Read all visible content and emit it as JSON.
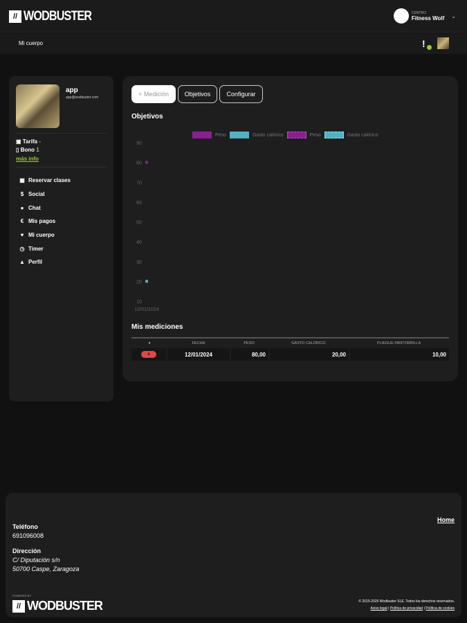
{
  "header": {
    "brand": "WODBUSTER",
    "brand_mark": "//",
    "centro_label": "CENTRO",
    "centro_name": "Fitness Wolf"
  },
  "subnav": {
    "title": "Mi cuerpo"
  },
  "user": {
    "name": "app",
    "email": "app@wodbuster.com",
    "tarifa_label": "Tarifa",
    "tarifa_value": "-",
    "bono_label": "Bono",
    "bono_value": "1",
    "more": "más info"
  },
  "menu": [
    {
      "icon": "calendar-icon",
      "glyph": "▦",
      "label": "Reservar clases"
    },
    {
      "icon": "social-icon",
      "glyph": "$",
      "label": "Social"
    },
    {
      "icon": "chat-icon",
      "glyph": "●",
      "label": "Chat"
    },
    {
      "icon": "euro-icon",
      "glyph": "€",
      "label": "Mis pagos"
    },
    {
      "icon": "heart-icon",
      "glyph": "♥",
      "label": "Mi cuerpo"
    },
    {
      "icon": "timer-icon",
      "glyph": "◷",
      "label": "Timer"
    },
    {
      "icon": "user-icon",
      "glyph": "▲",
      "label": "Perfil"
    }
  ],
  "main": {
    "buttons": {
      "add": "+ Medición",
      "goals": "Objetivos",
      "config": "Configurar"
    },
    "chart_title": "Objetivos",
    "table_title": "Mis mediciones",
    "columns": [
      "●",
      "FECHA",
      "PESO",
      "GASTO CALÓRICO",
      "PLIEGUE PANTORRILLA"
    ],
    "rows": [
      {
        "delete": "x",
        "fecha": "12/01/2024",
        "peso": "80,00",
        "gasto": "20,00",
        "pliegue": "10,00"
      }
    ]
  },
  "chart_data": {
    "type": "scatter",
    "title": "Objetivos",
    "x": [
      "12/01/2024"
    ],
    "ylim": [
      10,
      90
    ],
    "yticks": [
      "90",
      "80",
      "70",
      "60",
      "50",
      "40",
      "30",
      "20",
      "10"
    ],
    "legend": [
      "Peso",
      "Gasto calórico",
      "Peso",
      "Gasto calórico"
    ],
    "series": [
      {
        "name": "Peso",
        "color": "#8b1f8f",
        "values": [
          80
        ]
      },
      {
        "name": "Gasto calórico",
        "color": "#4fb3c4",
        "values": [
          20
        ]
      }
    ]
  },
  "footer": {
    "phone_label": "Teléfono",
    "phone": "691096008",
    "address_label": "Dirección",
    "address1": "C/ Diputación s/n",
    "address2": "50700 Caspe, Zaragoza",
    "home": "Home",
    "powered": "POWERED BY",
    "copyright": "© 2015-2025 Wodbuster SLE. Todos los derechos reservados.",
    "legal": "Aviso legal",
    "privacy": "Política de privacidad",
    "cookies": "Política de cookies"
  }
}
